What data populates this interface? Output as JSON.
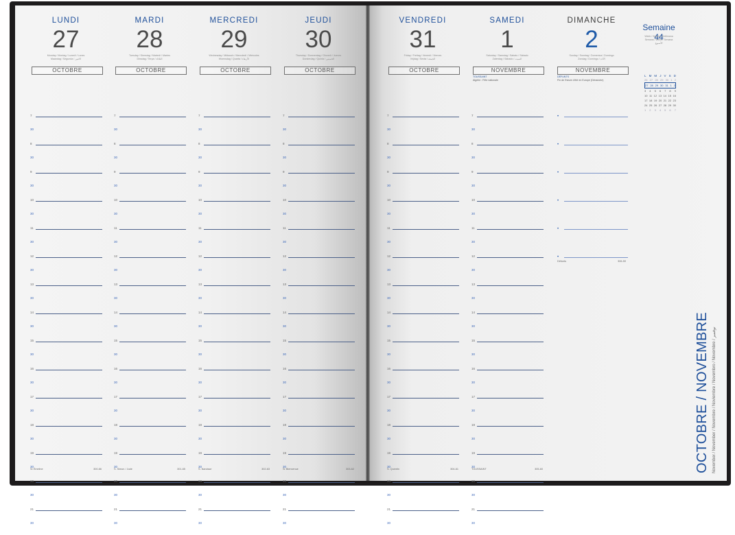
{
  "week": {
    "label": "Semaine",
    "number": "44",
    "subtitle": "Week / Woche / Settimana\nSemana / Week / Semana\nالأسبوع"
  },
  "days": [
    {
      "name": "LUNDI",
      "number": "27",
      "translations": "Monday / Montag / Lunedì / Lunes\nMaandag / Segunda / الاثنين",
      "month": "OCTOBRE",
      "note": "",
      "footer_saint": "Sr Émeline",
      "footer_day": "300-66"
    },
    {
      "name": "MARDI",
      "number": "28",
      "translations": "Tuesday / Dienstag / Martedì / Martes\nDinsdag / Terça / الثلاثاء",
      "month": "OCTOBRE",
      "note": "",
      "footer_saint": "S. Simon / Jude",
      "footer_day": "301-65"
    },
    {
      "name": "MERCREDI",
      "number": "29",
      "translations": "Wednesday / Mittwoch / Mercoledì / Miércoles\nWoensdag / Quarta / الأربعاء",
      "month": "OCTOBRE",
      "note": "",
      "footer_saint": "S. Narcisse",
      "footer_day": "302-63"
    },
    {
      "name": "JEUDI",
      "number": "30",
      "translations": "Thursday / Donnerstag / Giovedì / Jueves\nDonderdag / Quinta / الخميس",
      "month": "OCTOBRE",
      "note": "",
      "footer_saint": "Sr Bienvenue",
      "footer_day": "303-62"
    },
    {
      "name": "VENDREDI",
      "number": "31",
      "translations": "Friday / Freitag / Venerdì / Viernes\nVrijdag / Sexta / الجمعة",
      "month": "OCTOBRE",
      "note": "",
      "footer_saint": "S. Quentin",
      "footer_day": "304-61"
    },
    {
      "name": "SAMEDI",
      "number": "1",
      "translations": "Saturday / Samstag / Sabato / Sábado\nZaterdag / Sábado / السبت",
      "month": "NOVEMBRE",
      "note_title": "TOUSSAINT",
      "note": "Algérie : Fête nationale",
      "footer_saint": "TOUSSAINT",
      "footer_day": "305-60"
    },
    {
      "name": "DIMANCHE",
      "number": "2",
      "translations": "Sunday / Sonntag / Domenica / Domingo\nZondag / Domingo / الأحد",
      "month": "NOVEMBRE",
      "note_title": "DÉFUNTS",
      "note": "Fin de l'heure d'été en Europe (Dimanche)",
      "footer_saint": "Défunts",
      "footer_day": "306-59"
    }
  ],
  "mini_calendar": {
    "headers": [
      "L",
      "M",
      "M",
      "J",
      "V",
      "S",
      "D"
    ],
    "rows": [
      [
        "26",
        "27",
        "28",
        "29",
        "30",
        "1",
        "2"
      ],
      [
        "27",
        "28",
        "29",
        "30",
        "31",
        "1",
        "2"
      ],
      [
        "3",
        "4",
        "5",
        "6",
        "7",
        "8",
        "9"
      ],
      [
        "10",
        "11",
        "12",
        "13",
        "14",
        "15",
        "16"
      ],
      [
        "17",
        "18",
        "19",
        "20",
        "21",
        "22",
        "23"
      ],
      [
        "24",
        "25",
        "26",
        "27",
        "28",
        "29",
        "30"
      ],
      [
        "1",
        "2",
        "3",
        "4",
        "5",
        "6",
        "7"
      ]
    ]
  },
  "hours": [
    "7",
    "8",
    "9",
    "10",
    "11",
    "12",
    "13",
    "14",
    "15",
    "16",
    "17",
    "18",
    "19",
    "20",
    "21"
  ],
  "half_mark": "30",
  "sunday_bullet": "•",
  "side_title": "OCTOBRE / NOVEMBRE",
  "side_subtitle": "November / November / Novembre / Noviembre / Novembro / Novembre / نوفمبر"
}
